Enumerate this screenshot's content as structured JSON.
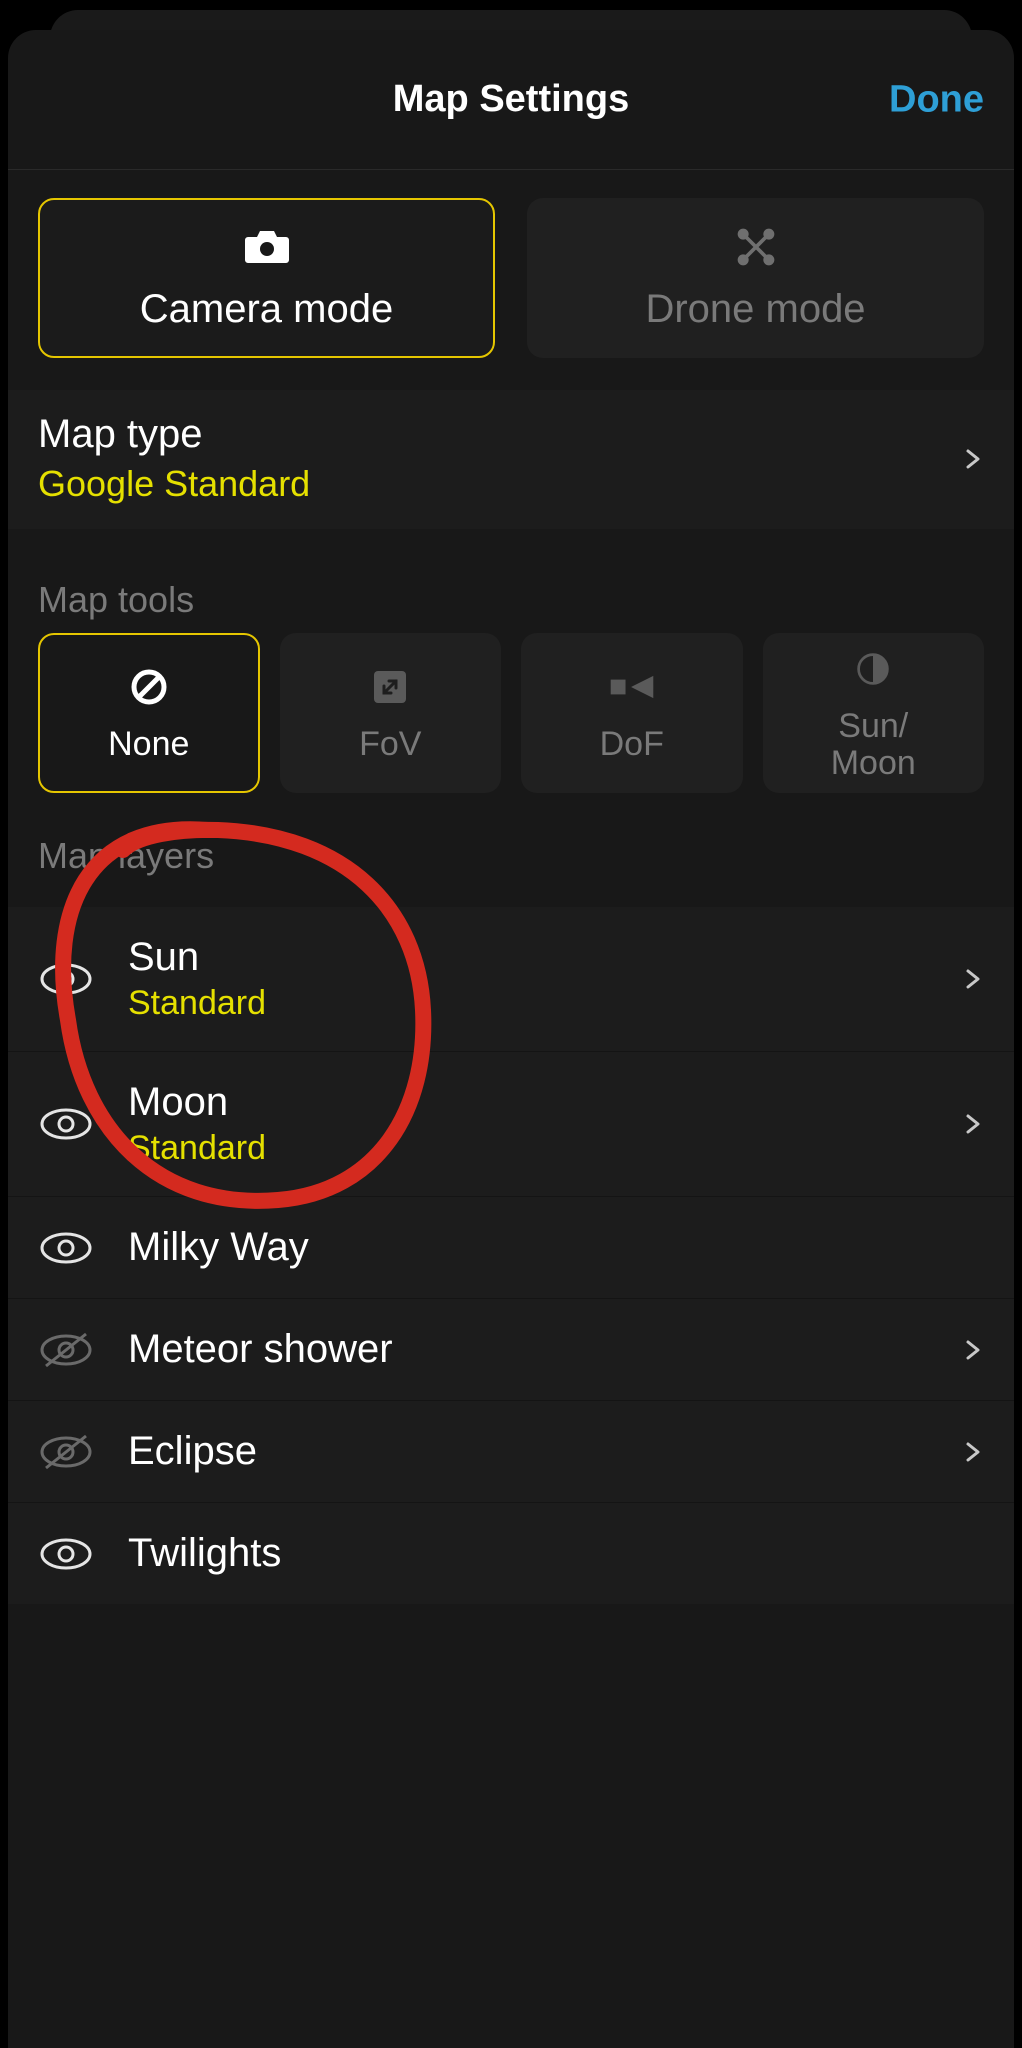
{
  "header": {
    "title": "Map Settings",
    "done": "Done"
  },
  "modes": {
    "camera": "Camera mode",
    "drone": "Drone mode",
    "selected": "camera"
  },
  "map_type": {
    "label": "Map type",
    "value": "Google Standard"
  },
  "sections": {
    "tools": "Map tools",
    "layers": "Map layers"
  },
  "tools": {
    "none": "None",
    "fov": "FoV",
    "dof": "DoF",
    "sunmoon": "Sun/\nMoon",
    "selected": "none"
  },
  "layers": [
    {
      "id": "sun",
      "title": "Sun",
      "sub": "Standard",
      "visible": true,
      "hasDetail": true
    },
    {
      "id": "moon",
      "title": "Moon",
      "sub": "Standard",
      "visible": true,
      "hasDetail": true
    },
    {
      "id": "milky",
      "title": "Milky Way",
      "sub": "",
      "visible": true,
      "hasDetail": false
    },
    {
      "id": "meteor",
      "title": "Meteor shower",
      "sub": "",
      "visible": false,
      "hasDetail": true
    },
    {
      "id": "eclipse",
      "title": "Eclipse",
      "sub": "",
      "visible": false,
      "hasDetail": true
    },
    {
      "id": "twi",
      "title": "Twilights",
      "sub": "",
      "visible": true,
      "hasDetail": false
    }
  ],
  "colors": {
    "accent": "#e5c600",
    "value_yellow": "#e5e000",
    "link_blue": "#2e9fd6"
  }
}
